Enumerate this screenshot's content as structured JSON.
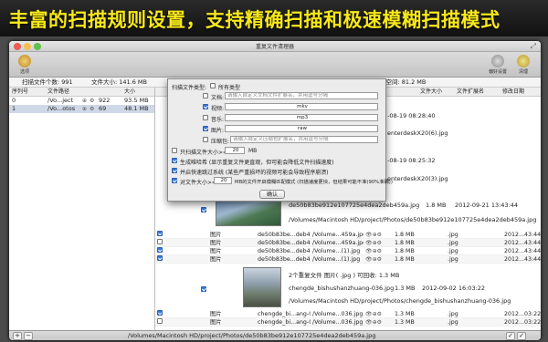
{
  "banner": {
    "text": "丰富的扫描规则设置，支持精确扫描和极速模糊扫描模式"
  },
  "window": {
    "title": "重复文件清理器"
  },
  "toolbar": {
    "scan_label": "选项",
    "fav_label": "偏好设置",
    "clean_label": "清理"
  },
  "stats": {
    "scanned_count": "扫描文件个数: 991",
    "file_size": "文件大小: 141.6 MB",
    "recoverable": "可回收磁盘空间: 81.2 MB"
  },
  "left_table": {
    "headers": [
      "序列号",
      "文件路径",
      "大小"
    ],
    "rows": [
      {
        "index": "0",
        "path": "/Vo...ject",
        "count": "922",
        "size": "93.5 MB"
      },
      {
        "index": "1",
        "path": "/Vo...otos",
        "count": "69",
        "size": "48.1 MB"
      }
    ]
  },
  "right_table": {
    "headers": [
      "文件大小",
      "文件扩展名",
      "修改日期"
    ],
    "snippets": [
      {
        "text": "-08-19 08:28:40"
      },
      {
        "text": "enterdeskX20(6).jpg"
      },
      {
        "text": "-08-19 08:25:32"
      },
      {
        "text": "enterdeskX20(3).jpg"
      }
    ],
    "group1": {
      "name": "de50b83be912e107725e4dea2deb459a.jpg",
      "size": "1.8 MB",
      "date": "2012-09-21 13:43:44",
      "path": "/Volumes/Macintosh HD/project/Photos/de50b83be912e107725e4dea2deb459a.jpg"
    },
    "group1_rows": [
      {
        "type": "图片",
        "name": "de50b83be...deb459a.jpg",
        "path": "/Volume...459a.jpg",
        "size": "1.8 MB",
        "ext": ".jpg",
        "date": "2012...43:44"
      },
      {
        "type": "图片",
        "name": "de50b83be...deb459a.jpg",
        "path": "/Volume...459a.jpg",
        "size": "1.8 MB",
        "ext": ".jpg",
        "date": "2012...43:44"
      },
      {
        "type": "图片",
        "name": "de50b83be...deb459a (1).jpg",
        "path": "/Volume...(1).jpg",
        "size": "1.8 MB",
        "ext": ".jpg",
        "date": "2012...43:44"
      },
      {
        "type": "图片",
        "name": "de50b83be...deb459a (1).jpg",
        "path": "/Volume...(1).jpg",
        "size": "1.8 MB",
        "ext": ".jpg",
        "date": "2012...43:44"
      }
    ],
    "group2_header": "2个重复文件    图片( .jpg )    可回收: 1.3 MB",
    "group2": {
      "name": "chengde_bishushanzhuang-036.jpg",
      "size": "1.3 MB",
      "date": "2012-09-02 16:03:22",
      "path": "/Volumes/Macintosh HD/project/Photos/chengde_bishushanzhuang-036.jpg"
    },
    "group2_rows": [
      {
        "type": "图片",
        "name": "chengde_bi...ang-036.jpg",
        "path": "/Volume...036.jpg",
        "size": "1.3 MB",
        "ext": ".jpg",
        "date": "2012...03:22"
      },
      {
        "type": "图片",
        "name": "chengde_bi...ang-036.jpg",
        "path": "/Volume...036.jpg",
        "size": "1.3 MB",
        "ext": ".jpg",
        "date": "2012...03:22"
      }
    ]
  },
  "statusbar": {
    "path": "/Volumes/Macintosh HD/project/Photos/de50b83be912e107725e4dea2deb459a.jpg"
  },
  "dialog": {
    "file_type_label": "扫描文件类型:",
    "all_types": "所有类型",
    "doc_label": "文档:",
    "doc_placeholder": "请输入自定义文档文件扩展名，并用逗号分隔",
    "video_label": "视频:",
    "video_value": "mkv",
    "music_label": "音乐:",
    "music_value": "mp3",
    "image_label": "图片:",
    "image_value": "raw",
    "archive_label": "压缩包:",
    "archive_placeholder": "请输入自定义压缩包扩展名，并用逗号分隔",
    "only_scan_label": "只扫描文件大小>=",
    "only_scan_value": "20",
    "only_scan_unit": "MB",
    "opt_hash": "生成唯哈希 (显示重复文件更直观，但可能会降低文件扫描速度)",
    "opt_system": "并启快速跳过系统 (某些严重损坏的视频可能会导致程序崩溃)",
    "opt_large_label": "对文件大小>=",
    "opt_large_value": "20",
    "opt_large_desc": "MB的文件开启模糊匹配模式 (扫描速度更快，但结果可能不准(90%准确))",
    "ok": "确认"
  }
}
